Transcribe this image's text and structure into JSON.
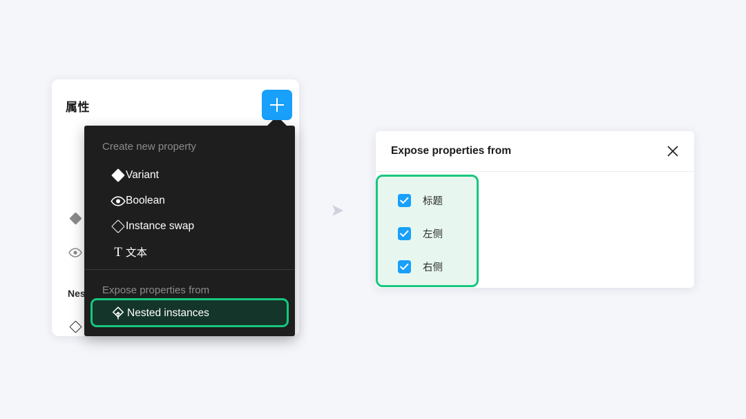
{
  "background_color": "#f5f6fa",
  "left_panel": {
    "title": "属性",
    "add_button": {
      "icon": "plus-icon",
      "color": "#18a0fb"
    },
    "background_rows": [
      {
        "icon": "diamond-filled-icon",
        "label": ""
      },
      {
        "icon": "eye-icon",
        "label": ""
      },
      {
        "icon": "",
        "label": "Nes"
      },
      {
        "icon": "diamond-outline-icon",
        "label": ""
      },
      {
        "icon": "diamond-outline-icon",
        "label": ""
      },
      {
        "icon": "diamond-outline-icon",
        "label": ""
      }
    ]
  },
  "dropdown_menu": {
    "background_color": "#1e1e1e",
    "create_section": {
      "label": "Create new property",
      "items": [
        {
          "icon": "diamond-filled-icon",
          "label": "Variant"
        },
        {
          "icon": "eye-icon",
          "label": "Boolean"
        },
        {
          "icon": "diamond-outline-icon",
          "label": "Instance swap"
        },
        {
          "icon": "text-t-icon",
          "label": "文本"
        }
      ]
    },
    "expose_section": {
      "label": "Expose properties from",
      "highlighted_item": {
        "icon": "nested-instance-icon",
        "label": "Nested instances",
        "highlight_border_color": "#18c77e",
        "highlight_fill_color": "#14352a"
      }
    }
  },
  "flow_arrow": {
    "icon": "arrow-right-icon",
    "color": "#ccd1dc"
  },
  "right_panel": {
    "title": "Expose properties from",
    "close_icon": "close-x-icon",
    "highlight_border_color": "#18c77e",
    "highlight_fill_color": "#e7f7ef",
    "checkboxes": [
      {
        "label": "标题",
        "checked": true
      },
      {
        "label": "左侧",
        "checked": true
      },
      {
        "label": "右侧",
        "checked": true
      }
    ]
  }
}
